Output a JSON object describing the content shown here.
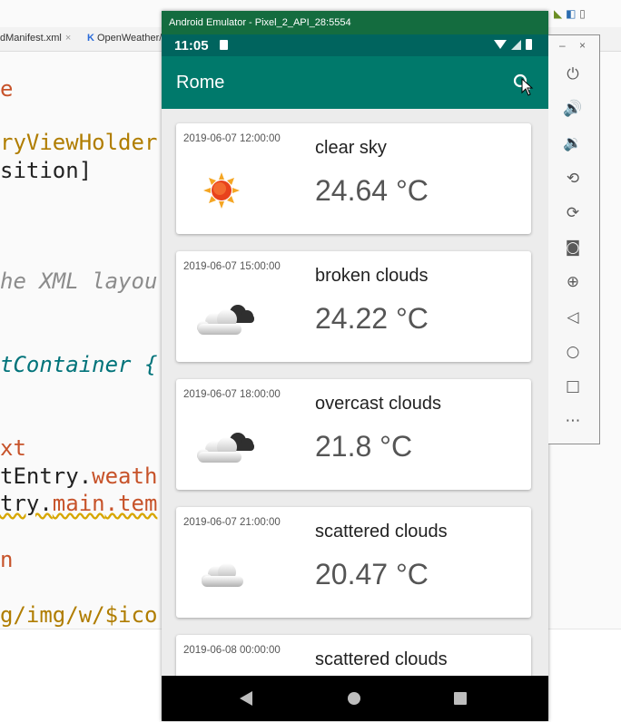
{
  "ide": {
    "tabs": [
      {
        "label": "dManifest.xml",
        "close": "×"
      },
      {
        "label": "OpenWeather/",
        "close": ""
      }
    ],
    "code_lines": [
      {
        "text": "e",
        "color": "orange"
      },
      {
        "text": "ryViewHolder",
        "color": "gold"
      },
      {
        "text": "sition]",
        "color": "dark"
      },
      {
        "text": "he XML layou",
        "color": "gray-italic"
      },
      {
        "text": "tContainer {",
        "color": "teal-italic"
      },
      {
        "text": "xt",
        "color": "orange"
      },
      {
        "text_a": "tEntry.",
        "text_b": "weath",
        "color": "mixed"
      },
      {
        "text_a": "try.",
        "text_b": "main",
        "text_c": ".tem",
        "color": "mixed"
      },
      {
        "text": "n",
        "color": "orange"
      },
      {
        "text": "g/img/w/$ico",
        "color": "gold"
      }
    ]
  },
  "emulator": {
    "window_title": "Android Emulator - Pixel_2_API_28:5554",
    "status_time": "11:05",
    "app_title": "Rome",
    "forecast": [
      {
        "date": "2019-06-07 12:00:00",
        "description": "clear sky",
        "temperature": "24.64 °C",
        "icon": "sun-icon"
      },
      {
        "date": "2019-06-07 15:00:00",
        "description": "broken clouds",
        "temperature": "24.22 °C",
        "icon": "dark-clouds-icon"
      },
      {
        "date": "2019-06-07 18:00:00",
        "description": "overcast clouds",
        "temperature": "21.8 °C",
        "icon": "dark-clouds-icon"
      },
      {
        "date": "2019-06-07 21:00:00",
        "description": "scattered clouds",
        "temperature": "20.47 °C",
        "icon": "cloud-icon"
      },
      {
        "date": "2019-06-08 00:00:00",
        "description": "scattered clouds",
        "temperature": "",
        "icon": "cloud-icon"
      }
    ],
    "side_toolbar": {
      "minimize": "–",
      "close": "×",
      "buttons": [
        "power-icon",
        "volume-up-icon",
        "volume-down-icon",
        "rotate-left-icon",
        "rotate-right-icon",
        "camera-icon",
        "zoom-icon",
        "back-icon",
        "home-icon",
        "overview-icon",
        "more-icon"
      ]
    }
  },
  "colors": {
    "app_bar": "#00796b",
    "status_bar": "#00645e",
    "emulator_title": "#146c3f"
  }
}
